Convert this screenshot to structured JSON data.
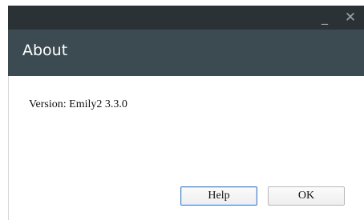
{
  "window": {
    "minimize_label": "_",
    "close_label": "✕"
  },
  "header": {
    "title": "About"
  },
  "content": {
    "version_text": "Version: Emily2 3.3.0"
  },
  "buttons": {
    "help_label": "Help",
    "ok_label": "OK"
  },
  "colors": {
    "titlebar": "#2b3236",
    "header": "#3b4b51",
    "focus_border": "#3c7fd6"
  }
}
